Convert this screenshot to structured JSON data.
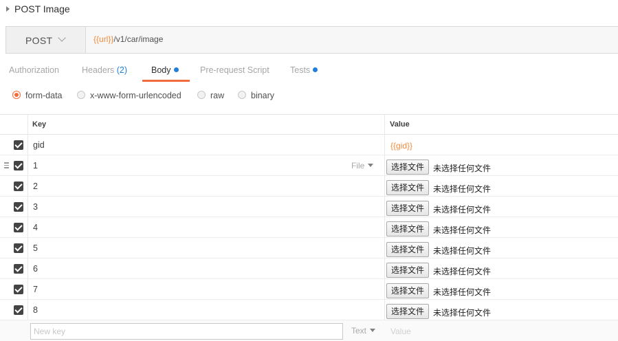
{
  "request": {
    "title": "POST Image",
    "method": "POST",
    "url_var": "{{url}}",
    "url_path": "/v1/car/image"
  },
  "tabs": [
    {
      "label": "Authorization"
    },
    {
      "label": "Headers",
      "count": "(2)"
    },
    {
      "label": "Body",
      "has_dot": true,
      "active": true
    },
    {
      "label": "Pre-request Script"
    },
    {
      "label": "Tests",
      "has_dot": true
    }
  ],
  "body_modes": [
    {
      "label": "form-data",
      "checked": true
    },
    {
      "label": "x-www-form-urlencoded"
    },
    {
      "label": "raw"
    },
    {
      "label": "binary"
    }
  ],
  "table": {
    "key_header": "Key",
    "value_header": "Value",
    "rows": [
      {
        "key": "gid",
        "value": "{{gid}}"
      },
      {
        "key": "1",
        "type": "File",
        "file_button": "选择文件",
        "file_status": "未选择任何文件"
      },
      {
        "key": "2",
        "file_button": "选择文件",
        "file_status": "未选择任何文件"
      },
      {
        "key": "3",
        "file_button": "选择文件",
        "file_status": "未选择任何文件"
      },
      {
        "key": "4",
        "file_button": "选择文件",
        "file_status": "未选择任何文件"
      },
      {
        "key": "5",
        "file_button": "选择文件",
        "file_status": "未选择任何文件"
      },
      {
        "key": "6",
        "file_button": "选择文件",
        "file_status": "未选择任何文件"
      },
      {
        "key": "7",
        "file_button": "选择文件",
        "file_status": "未选择任何文件"
      },
      {
        "key": "8",
        "file_button": "选择文件",
        "file_status": "未选择任何文件"
      }
    ],
    "new_row": {
      "key_placeholder": "New key",
      "type": "Text",
      "value_placeholder": "Value"
    }
  },
  "colors": {
    "accent": "#f26b3a",
    "variable": "#f08b3a",
    "tab_dot": "#1f7fd9"
  }
}
